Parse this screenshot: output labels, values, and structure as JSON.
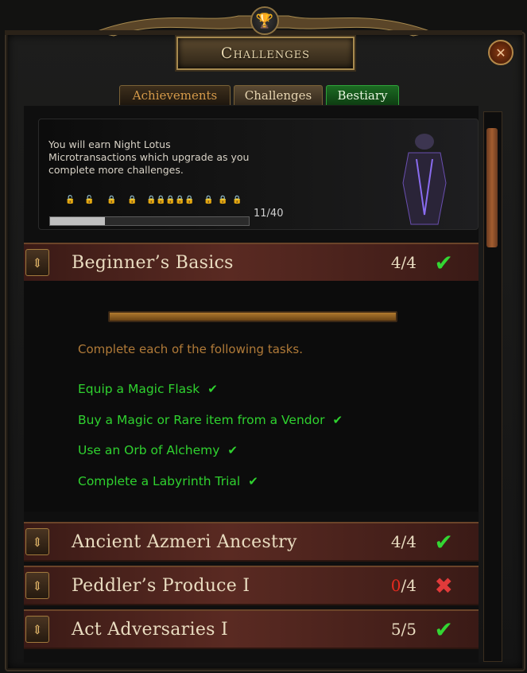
{
  "window": {
    "title": "Challenges"
  },
  "tabs": [
    {
      "label": "Achievements"
    },
    {
      "label": "Challenges"
    },
    {
      "label": "Bestiary"
    }
  ],
  "banner": {
    "text": "You will earn Night Lotus Microtransactions which upgrade as you complete more challenges.",
    "progress_label": "11/40",
    "progress_fraction": 0.275
  },
  "challenges": [
    {
      "name": "Beginner’s Basics",
      "count": "4/4",
      "status": "complete",
      "expanded": true
    },
    {
      "name": "Ancient Azmeri Ancestry",
      "count": "4/4",
      "status": "complete",
      "expanded": false
    },
    {
      "name": "Peddler’s Produce I",
      "count_done": "0",
      "count_total": "/4",
      "status": "incomplete",
      "expanded": false
    },
    {
      "name": "Act Adversaries I",
      "count": "5/5",
      "status": "complete",
      "expanded": false
    }
  ],
  "details": {
    "intro": "Complete each of the following tasks.",
    "tasks": [
      {
        "label": "Equip a Magic Flask",
        "done": true
      },
      {
        "label": "Buy a Magic or Rare item from a Vendor",
        "done": true
      },
      {
        "label": "Use an Orb of Alchemy",
        "done": true
      },
      {
        "label": "Complete a Labyrinth Trial",
        "done": true
      }
    ]
  },
  "icons": {
    "check": "✔",
    "cross": "✖",
    "close": "✕",
    "toggle": "⇕",
    "trophy": "🏆"
  },
  "colors": {
    "accent_green": "#33d633",
    "error_red": "#e52a1f",
    "gold": "#b07a38"
  }
}
